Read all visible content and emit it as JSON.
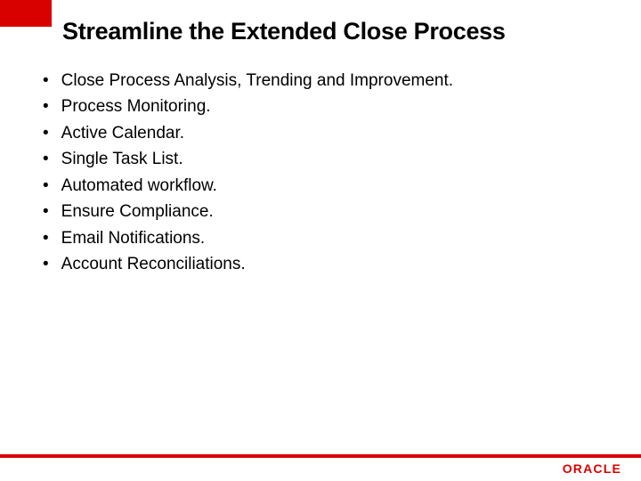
{
  "title": "Streamline the Extended Close Process",
  "bullets": [
    "Close Process Analysis, Trending and Improvement.",
    "Process Monitoring.",
    "Active Calendar.",
    "Single Task List.",
    "Automated workflow.",
    "Ensure Compliance.",
    "Email Notifications.",
    "Account Reconciliations."
  ],
  "logo": "ORACLE"
}
